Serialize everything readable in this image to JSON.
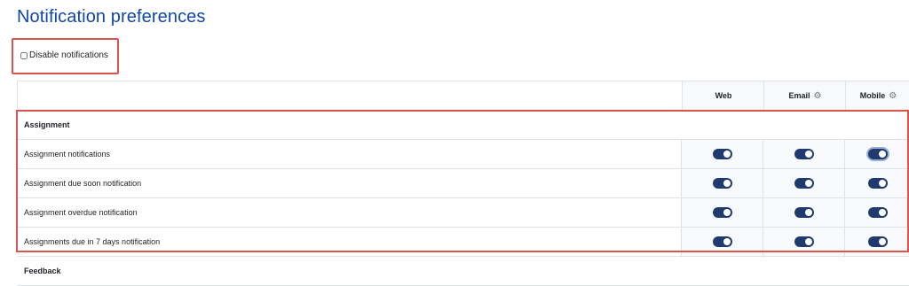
{
  "page": {
    "title": "Notification preferences"
  },
  "disable": {
    "label": "Disable notifications",
    "checked": false
  },
  "columns": {
    "web": "Web",
    "email": "Email",
    "mobile": "Mobile"
  },
  "groups": [
    {
      "name": "Assignment",
      "items": [
        {
          "label": "Assignment notifications",
          "web": true,
          "email": true,
          "mobile": true
        },
        {
          "label": "Assignment due soon notification",
          "web": true,
          "email": true,
          "mobile": true
        },
        {
          "label": "Assignment overdue notification",
          "web": true,
          "email": true,
          "mobile": true
        },
        {
          "label": "Assignments due in 7 days notification",
          "web": true,
          "email": true,
          "mobile": true
        }
      ]
    },
    {
      "name": "Feedback"
    }
  ],
  "icons": {
    "settings": "gear-icon"
  },
  "colors": {
    "title": "#0f47ad",
    "toggle_on": "#1f3a6e",
    "highlight": "#d9534f"
  }
}
